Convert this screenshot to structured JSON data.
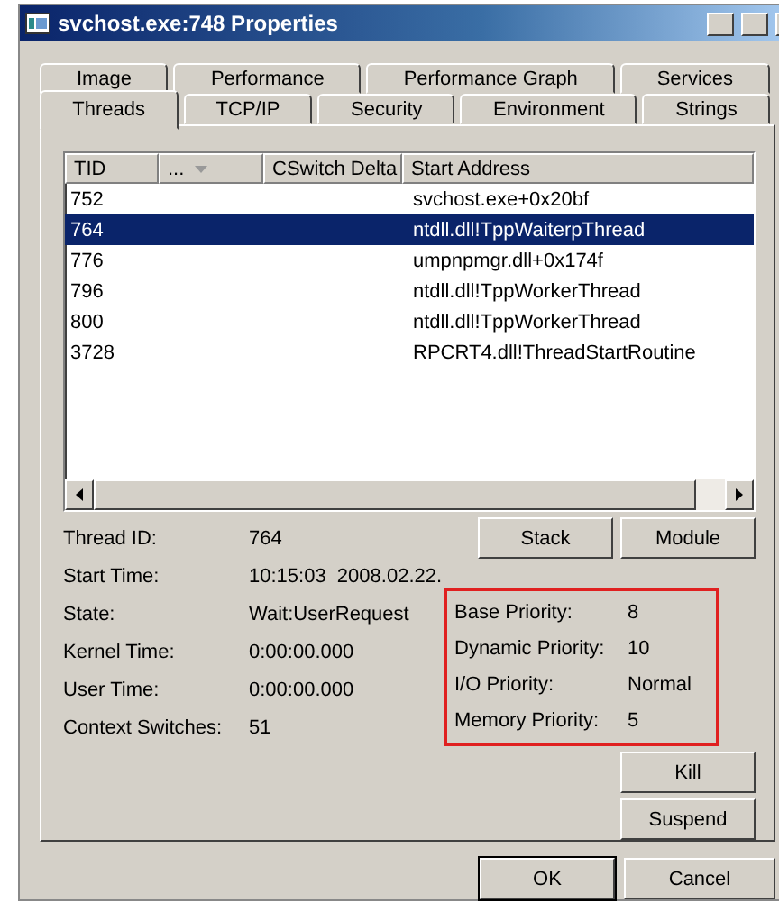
{
  "window": {
    "title": "svchost.exe:748 Properties"
  },
  "tab_rows": [
    [
      {
        "label": "Image",
        "selected": false
      },
      {
        "label": "Performance",
        "selected": false
      },
      {
        "label": "Performance Graph",
        "selected": false
      },
      {
        "label": "Services",
        "selected": false
      }
    ],
    [
      {
        "label": "Threads",
        "selected": true
      },
      {
        "label": "TCP/IP",
        "selected": false
      },
      {
        "label": "Security",
        "selected": false
      },
      {
        "label": "Environment",
        "selected": false
      },
      {
        "label": "Strings",
        "selected": false
      }
    ]
  ],
  "table": {
    "columns": [
      "TID",
      "...",
      "CSwitch Delta",
      "Start Address"
    ],
    "rows": [
      {
        "tid": "752",
        "address": "svchost.exe+0x20bf",
        "selected": false
      },
      {
        "tid": "764",
        "address": "ntdll.dll!TppWaiterpThread",
        "selected": true
      },
      {
        "tid": "776",
        "address": "umpnpmgr.dll+0x174f",
        "selected": false
      },
      {
        "tid": "796",
        "address": "ntdll.dll!TppWorkerThread",
        "selected": false
      },
      {
        "tid": "800",
        "address": "ntdll.dll!TppWorkerThread",
        "selected": false
      },
      {
        "tid": "3728",
        "address": "RPCRT4.dll!ThreadStartRoutine",
        "selected": false
      }
    ]
  },
  "details": [
    {
      "label": "Thread ID:",
      "value": "764"
    },
    {
      "label": "Start Time:",
      "value": "10:15:03  2008.02.22."
    },
    {
      "label": "State:",
      "value": "Wait:UserRequest"
    },
    {
      "label": "Kernel Time:",
      "value": "0:00:00.000"
    },
    {
      "label": "User Time:",
      "value": "0:00:00.000"
    },
    {
      "label": "Context Switches:",
      "value": "51"
    }
  ],
  "priorities": [
    {
      "label": "Base Priority:",
      "value": "8"
    },
    {
      "label": "Dynamic Priority:",
      "value": "10"
    },
    {
      "label": "I/O Priority:",
      "value": "Normal"
    },
    {
      "label": "Memory Priority:",
      "value": "5"
    }
  ],
  "top_buttons": [
    "Stack",
    "Module"
  ],
  "side_buttons": [
    "Kill",
    "Suspend"
  ],
  "dialog_buttons": [
    {
      "label": "OK",
      "default": true
    },
    {
      "label": "Cancel",
      "default": false
    }
  ]
}
